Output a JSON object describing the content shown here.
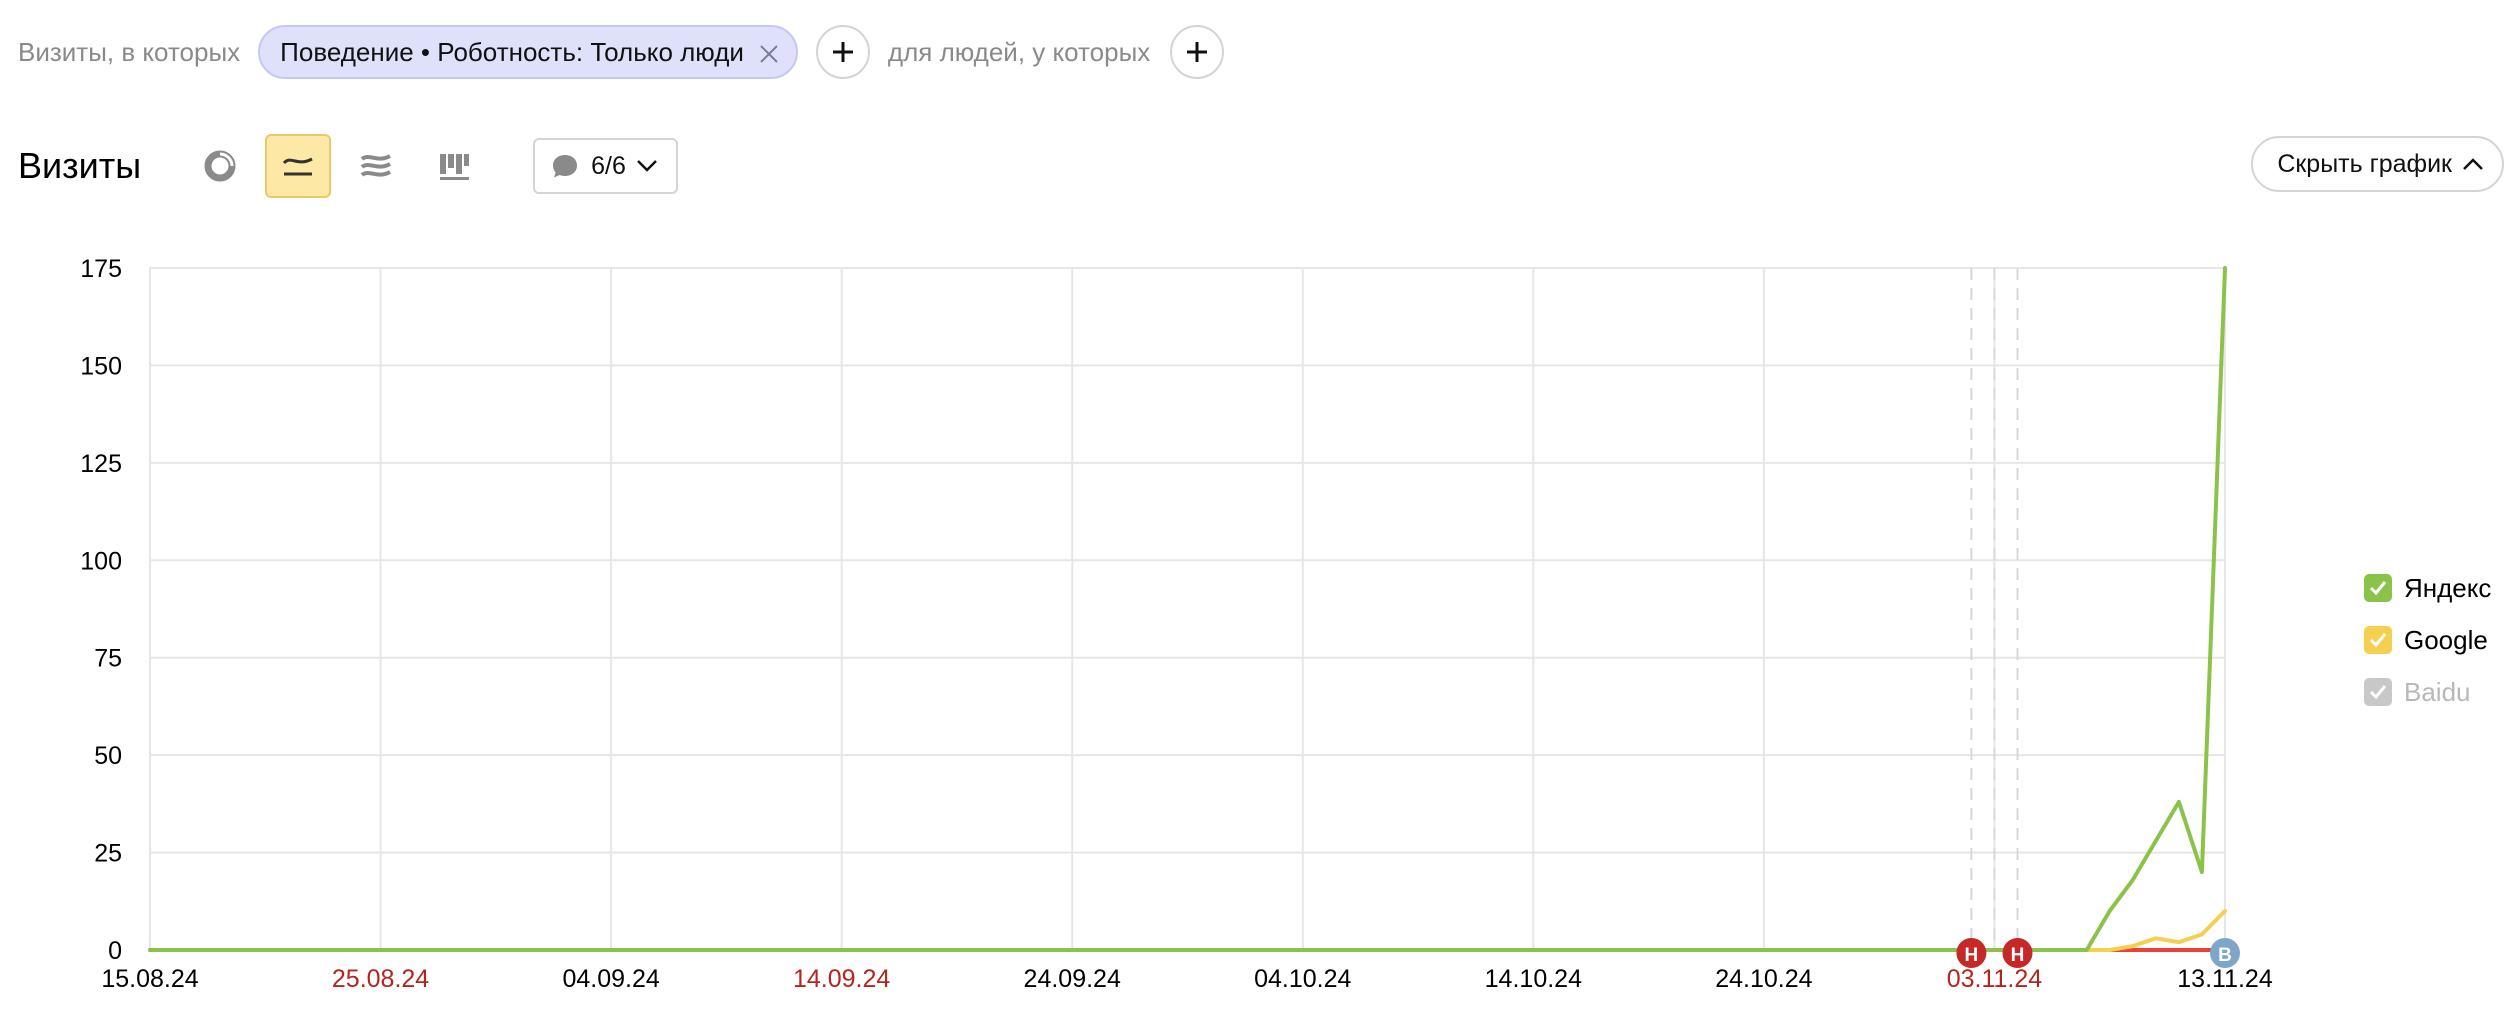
{
  "filters": {
    "visits_label": "Визиты, в которых",
    "chip_label": "Поведение • Роботность: Только люди",
    "people_label": "для людей, у которых"
  },
  "toolbar": {
    "title": "Визиты",
    "notes_count": "6/6",
    "hide_chart_label": "Скрыть график"
  },
  "colors": {
    "yandex": "#8bc34a",
    "google": "#f5cf4f",
    "baidu": "#ea4335",
    "baidu_legend": "#c8c8c8",
    "holiday_text": "#b3261e",
    "holiday_marker": "#c62828",
    "note_marker": "#7ea6c9",
    "grid": "#e6e6e6",
    "axis_text": "#000000"
  },
  "chart_data": {
    "type": "line",
    "x_tick_labels": [
      "15.08.24",
      "25.08.24",
      "04.09.24",
      "14.09.24",
      "24.09.24",
      "04.10.24",
      "14.10.24",
      "24.10.24",
      "03.11.24",
      "13.11.24"
    ],
    "x_tick_holiday": [
      false,
      true,
      false,
      true,
      false,
      false,
      false,
      false,
      true,
      false
    ],
    "y_ticks": [
      0,
      25,
      50,
      75,
      100,
      125,
      150,
      175
    ],
    "ylim": [
      0,
      175
    ],
    "x_range": [
      "2024-08-15",
      "2024-11-13"
    ],
    "grid": true,
    "legend_position": "right",
    "series": [
      {
        "name": "Яндекс",
        "color": "#8bc34a",
        "enabled": true,
        "points": [
          [
            "2024-08-15",
            0
          ],
          [
            "2024-11-07",
            0
          ],
          [
            "2024-11-08",
            10
          ],
          [
            "2024-11-09",
            18
          ],
          [
            "2024-11-10",
            28
          ],
          [
            "2024-11-11",
            38
          ],
          [
            "2024-11-12",
            20
          ],
          [
            "2024-11-13",
            175
          ]
        ]
      },
      {
        "name": "Google",
        "color": "#f5cf4f",
        "enabled": true,
        "points": [
          [
            "2024-08-15",
            0
          ],
          [
            "2024-11-08",
            0
          ],
          [
            "2024-11-09",
            1
          ],
          [
            "2024-11-10",
            3
          ],
          [
            "2024-11-11",
            2
          ],
          [
            "2024-11-12",
            4
          ],
          [
            "2024-11-13",
            10
          ]
        ]
      },
      {
        "name": "Baidu",
        "color": "#ea4335",
        "enabled": false,
        "points": [
          [
            "2024-08-15",
            0
          ],
          [
            "2024-11-13",
            0
          ]
        ]
      }
    ],
    "dashed_verticals": [
      "2024-11-02",
      "2024-11-03",
      "2024-11-04"
    ],
    "markers": [
      {
        "date": "2024-11-02",
        "letter": "Н",
        "kind": "holiday"
      },
      {
        "date": "2024-11-04",
        "letter": "Н",
        "kind": "holiday"
      },
      {
        "date": "2024-11-13",
        "letter": "В",
        "kind": "note"
      }
    ]
  }
}
